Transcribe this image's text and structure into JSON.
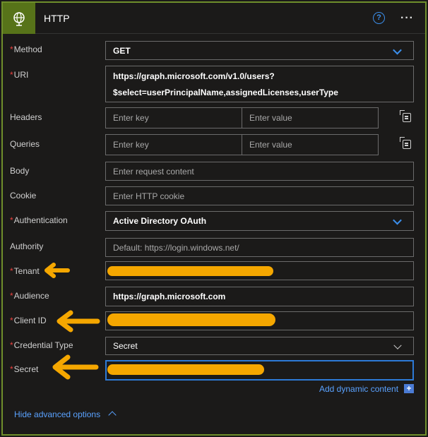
{
  "header": {
    "title": "HTTP",
    "icon": "globe-icon",
    "help_icon": "help-icon",
    "more_icon": "more-options-icon"
  },
  "fields": {
    "method": {
      "label": "Method",
      "required": "*",
      "value": "GET"
    },
    "uri": {
      "label": "URI",
      "required": "*",
      "line1": "https://graph.microsoft.com/v1.0/users?",
      "line2": "$select=userPrincipalName,assignedLicenses,userType"
    },
    "headers": {
      "label": "Headers",
      "key_placeholder": "Enter key",
      "value_placeholder": "Enter value"
    },
    "queries": {
      "label": "Queries",
      "key_placeholder": "Enter key",
      "value_placeholder": "Enter value"
    },
    "body": {
      "label": "Body",
      "placeholder": "Enter request content"
    },
    "cookie": {
      "label": "Cookie",
      "placeholder": "Enter HTTP cookie"
    },
    "authentication": {
      "label": "Authentication",
      "required": "*",
      "value": "Active Directory OAuth"
    },
    "authority": {
      "label": "Authority",
      "placeholder": "Default: https://login.windows.net/"
    },
    "tenant": {
      "label": "Tenant",
      "required": "*"
    },
    "audience": {
      "label": "Audience",
      "required": "*",
      "value": "https://graph.microsoft.com"
    },
    "client_id": {
      "label": "Client ID",
      "required": "*"
    },
    "credential_type": {
      "label": "Credential Type",
      "required": "*",
      "value": "Secret"
    },
    "secret": {
      "label": "Secret",
      "required": "*"
    }
  },
  "actions": {
    "add_dynamic_content": "Add dynamic content",
    "add_plus": "+",
    "hide_advanced": "Hide advanced options"
  },
  "colors": {
    "accent_green": "#577319",
    "border_green": "#6f8f2b",
    "link_blue": "#5aa2ff",
    "required_red": "#e8413e",
    "redaction_orange": "#f5a700"
  }
}
